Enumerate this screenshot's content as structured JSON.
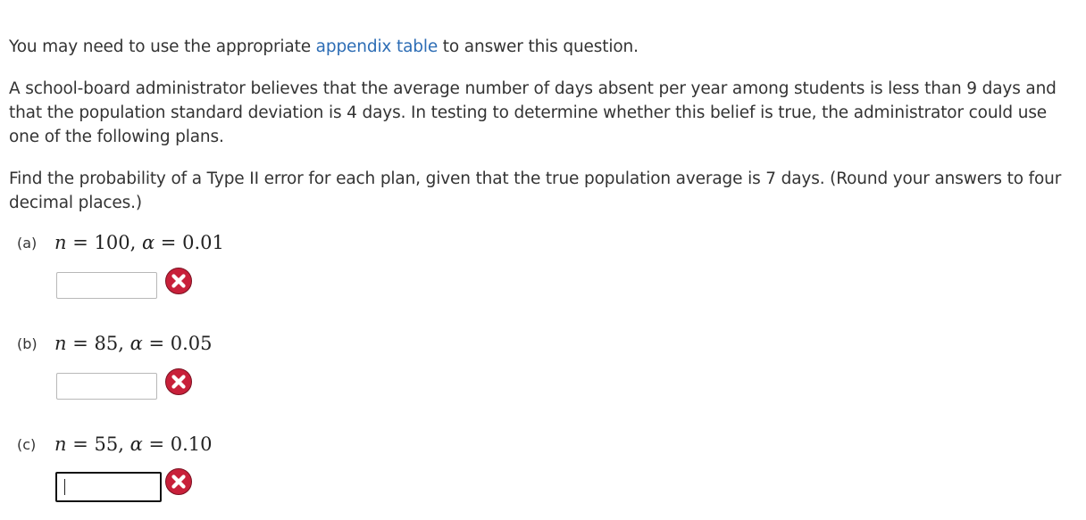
{
  "intro": {
    "prefix": "You may need to use the appropriate ",
    "link_text": "appendix table",
    "suffix": " to answer this question."
  },
  "problem": {
    "statement": "A school-board administrator believes that the average number of days absent per year among students is less than 9 days and that the population standard deviation is 4 days. In testing to determine whether this belief is true, the administrator could use one of the following plans.",
    "instruction": "Find the probability of a Type II error for each plan, given that the true population average is 7 days. (Round your answers to four decimal places.)"
  },
  "parts": [
    {
      "label": "(a)",
      "n_symbol": "n",
      "n_value": "100",
      "alpha_symbol": "α",
      "alpha_value": "0.01",
      "answer": ""
    },
    {
      "label": "(b)",
      "n_symbol": "n",
      "n_value": "85",
      "alpha_symbol": "α",
      "alpha_value": "0.05",
      "answer": ""
    },
    {
      "label": "(c)",
      "n_symbol": "n",
      "n_value": "55",
      "alpha_symbol": "α",
      "alpha_value": "0.10",
      "answer": ""
    }
  ],
  "colors": {
    "text": "#333333",
    "link": "#2d6db5",
    "incorrect_icon": "#c8203a"
  },
  "icons": {
    "incorrect": "x-circle-icon"
  }
}
